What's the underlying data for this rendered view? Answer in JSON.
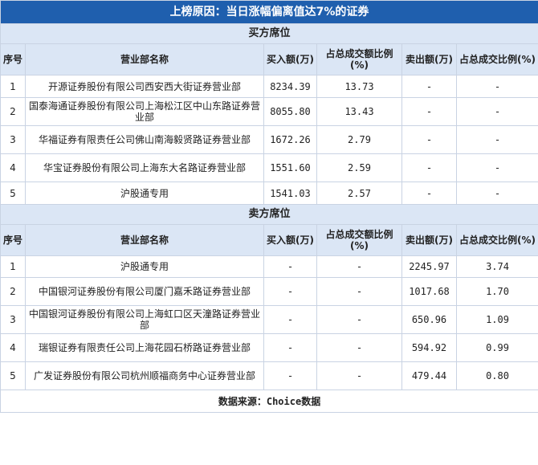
{
  "title": "上榜原因：当日涨幅偏离值达7%的证券",
  "buy_section_label": "买方席位",
  "sell_section_label": "卖方席位",
  "columns": {
    "seq": "序号",
    "name": "营业部名称",
    "buy": "买入额(万)",
    "buy_pct": "占总成交额比例(%)",
    "sell": "卖出额(万)",
    "sell_pct": "占总成交比例(%)"
  },
  "buy_rows": [
    {
      "seq": "1",
      "name": "开源证券股份有限公司西安西大街证券营业部",
      "buy": "8234.39",
      "buy_pct": "13.73",
      "sell": "-",
      "sell_pct": "-"
    },
    {
      "seq": "2",
      "name": "国泰海通证券股份有限公司上海松江区中山东路证券营业部",
      "buy": "8055.80",
      "buy_pct": "13.43",
      "sell": "-",
      "sell_pct": "-"
    },
    {
      "seq": "3",
      "name": "华福证券有限责任公司佛山南海毅贤路证券营业部",
      "buy": "1672.26",
      "buy_pct": "2.79",
      "sell": "-",
      "sell_pct": "-"
    },
    {
      "seq": "4",
      "name": "华宝证券股份有限公司上海东大名路证券营业部",
      "buy": "1551.60",
      "buy_pct": "2.59",
      "sell": "-",
      "sell_pct": "-"
    },
    {
      "seq": "5",
      "name": "沪股通专用",
      "buy": "1541.03",
      "buy_pct": "2.57",
      "sell": "-",
      "sell_pct": "-"
    }
  ],
  "sell_rows": [
    {
      "seq": "1",
      "name": "沪股通专用",
      "buy": "-",
      "buy_pct": "-",
      "sell": "2245.97",
      "sell_pct": "3.74"
    },
    {
      "seq": "2",
      "name": "中国银河证券股份有限公司厦门嘉禾路证券营业部",
      "buy": "-",
      "buy_pct": "-",
      "sell": "1017.68",
      "sell_pct": "1.70"
    },
    {
      "seq": "3",
      "name": "中国银河证券股份有限公司上海虹口区天潼路证券营业部",
      "buy": "-",
      "buy_pct": "-",
      "sell": "650.96",
      "sell_pct": "1.09"
    },
    {
      "seq": "4",
      "name": "瑞银证券有限责任公司上海花园石桥路证券营业部",
      "buy": "-",
      "buy_pct": "-",
      "sell": "594.92",
      "sell_pct": "0.99"
    },
    {
      "seq": "5",
      "name": "广发证券股份有限公司杭州顺福商务中心证券营业部",
      "buy": "-",
      "buy_pct": "-",
      "sell": "479.44",
      "sell_pct": "0.80"
    }
  ],
  "footer": {
    "label": "数据来源：",
    "source": "Choice",
    "suffix": "数据"
  },
  "colors": {
    "title_bg": "#1f5fae",
    "header_bg": "#dbe6f5",
    "border": "#c9d3e3"
  }
}
